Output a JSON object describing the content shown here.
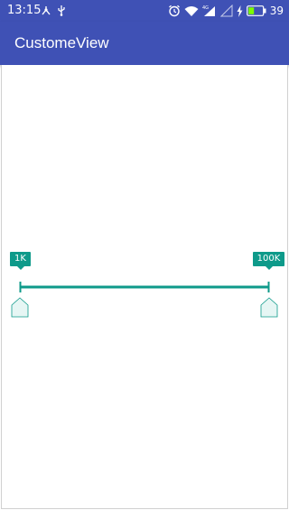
{
  "status_bar": {
    "time": "13:15",
    "battery_percent": "39",
    "icons": [
      "usb-icon",
      "trident-icon",
      "alarm-icon",
      "wifi-icon",
      "signal-4g-icon",
      "signal-icon",
      "charging-icon",
      "battery-icon"
    ],
    "network_label": "4G"
  },
  "app_bar": {
    "title": "CustomeView"
  },
  "range_seekbar": {
    "min_label": "1K",
    "max_label": "100K",
    "min_fraction": 0.0,
    "max_fraction": 1.0
  },
  "colors": {
    "primary": "#3F51B5",
    "accent": "#0E9A8A",
    "thumb_fill": "#E6F6F4"
  }
}
